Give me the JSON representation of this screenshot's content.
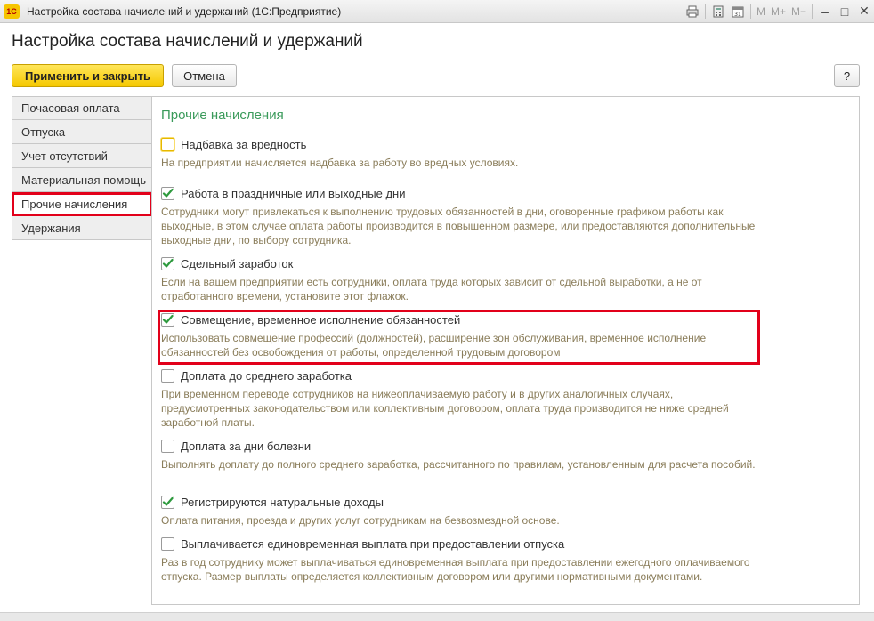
{
  "window": {
    "title": "Настройка состава начислений и удержаний  (1С:Предприятие)",
    "memory_buttons": [
      "M",
      "M+",
      "M−"
    ],
    "icons": [
      "print-icon",
      "calculator-icon",
      "calendar-icon"
    ]
  },
  "page_title": "Настройка состава начислений и удержаний",
  "toolbar": {
    "apply_close_label": "Применить и закрыть",
    "cancel_label": "Отмена",
    "help_label": "?"
  },
  "nav": {
    "items": [
      {
        "label": "Почасовая оплата"
      },
      {
        "label": "Отпуска"
      },
      {
        "label": "Учет отсутствий"
      },
      {
        "label": "Материальная помощь"
      },
      {
        "label": "Прочие начисления"
      },
      {
        "label": "Удержания"
      }
    ],
    "active_index": 4
  },
  "section_title": "Прочие начисления",
  "options": [
    {
      "label": "Надбавка за вредность",
      "checked": false,
      "description": "На предприятии начисляется надбавка за работу во вредных условиях."
    },
    {
      "label": "Работа в праздничные или выходные дни",
      "checked": true,
      "description": "Сотрудники могут привлекаться к выполнению трудовых обязанностей в дни, оговоренные графиком работы как выходные, в этом случае оплата работы производится в повышенном размере, или предоставляются дополнительные выходные дни, по выбору сотрудника."
    },
    {
      "label": "Сдельный заработок",
      "checked": true,
      "description": "Если на вашем предприятии есть сотрудники, оплата труда которых зависит от сдельной выработки, а не от отработанного времени, установите этот флажок."
    },
    {
      "label": "Совмещение, временное исполнение обязанностей",
      "checked": true,
      "description": "Использовать совмещение профессий (должностей), расширение зон обслуживания, временное исполнение обязанностей без освобождения от работы, определенной трудовым договором"
    },
    {
      "label": "Доплата до среднего заработка",
      "checked": false,
      "description": "При временном переводе сотрудников на нижеоплачиваемую работу и в других аналогичных случаях, предусмотренных законодательством или коллективным договором, оплата труда производится не ниже средней заработной платы."
    },
    {
      "label": "Доплата за дни болезни",
      "checked": false,
      "description": "Выполнять доплату до полного среднего заработка, рассчитанного по правилам, установленным для расчета пособий."
    },
    {
      "label": "Регистрируются натуральные доходы",
      "checked": true,
      "description": "Оплата питания, проезда и других услуг сотрудникам на безвозмездной основе."
    },
    {
      "label": "Выплачивается единовременная выплата при предоставлении отпуска",
      "checked": false,
      "description": "Раз в год сотруднику может выплачиваться единовременная выплата при предоставлении ежегодного оплачиваемого отпуска. Размер выплаты определяется коллективным договором или другими нормативными документами."
    }
  ],
  "colors": {
    "accent_yellow": "#f5c800",
    "section_green": "#3a9a5a",
    "highlight_red": "#e2001a",
    "check_green": "#2e9a3e",
    "description_text": "#8a7d5a"
  }
}
